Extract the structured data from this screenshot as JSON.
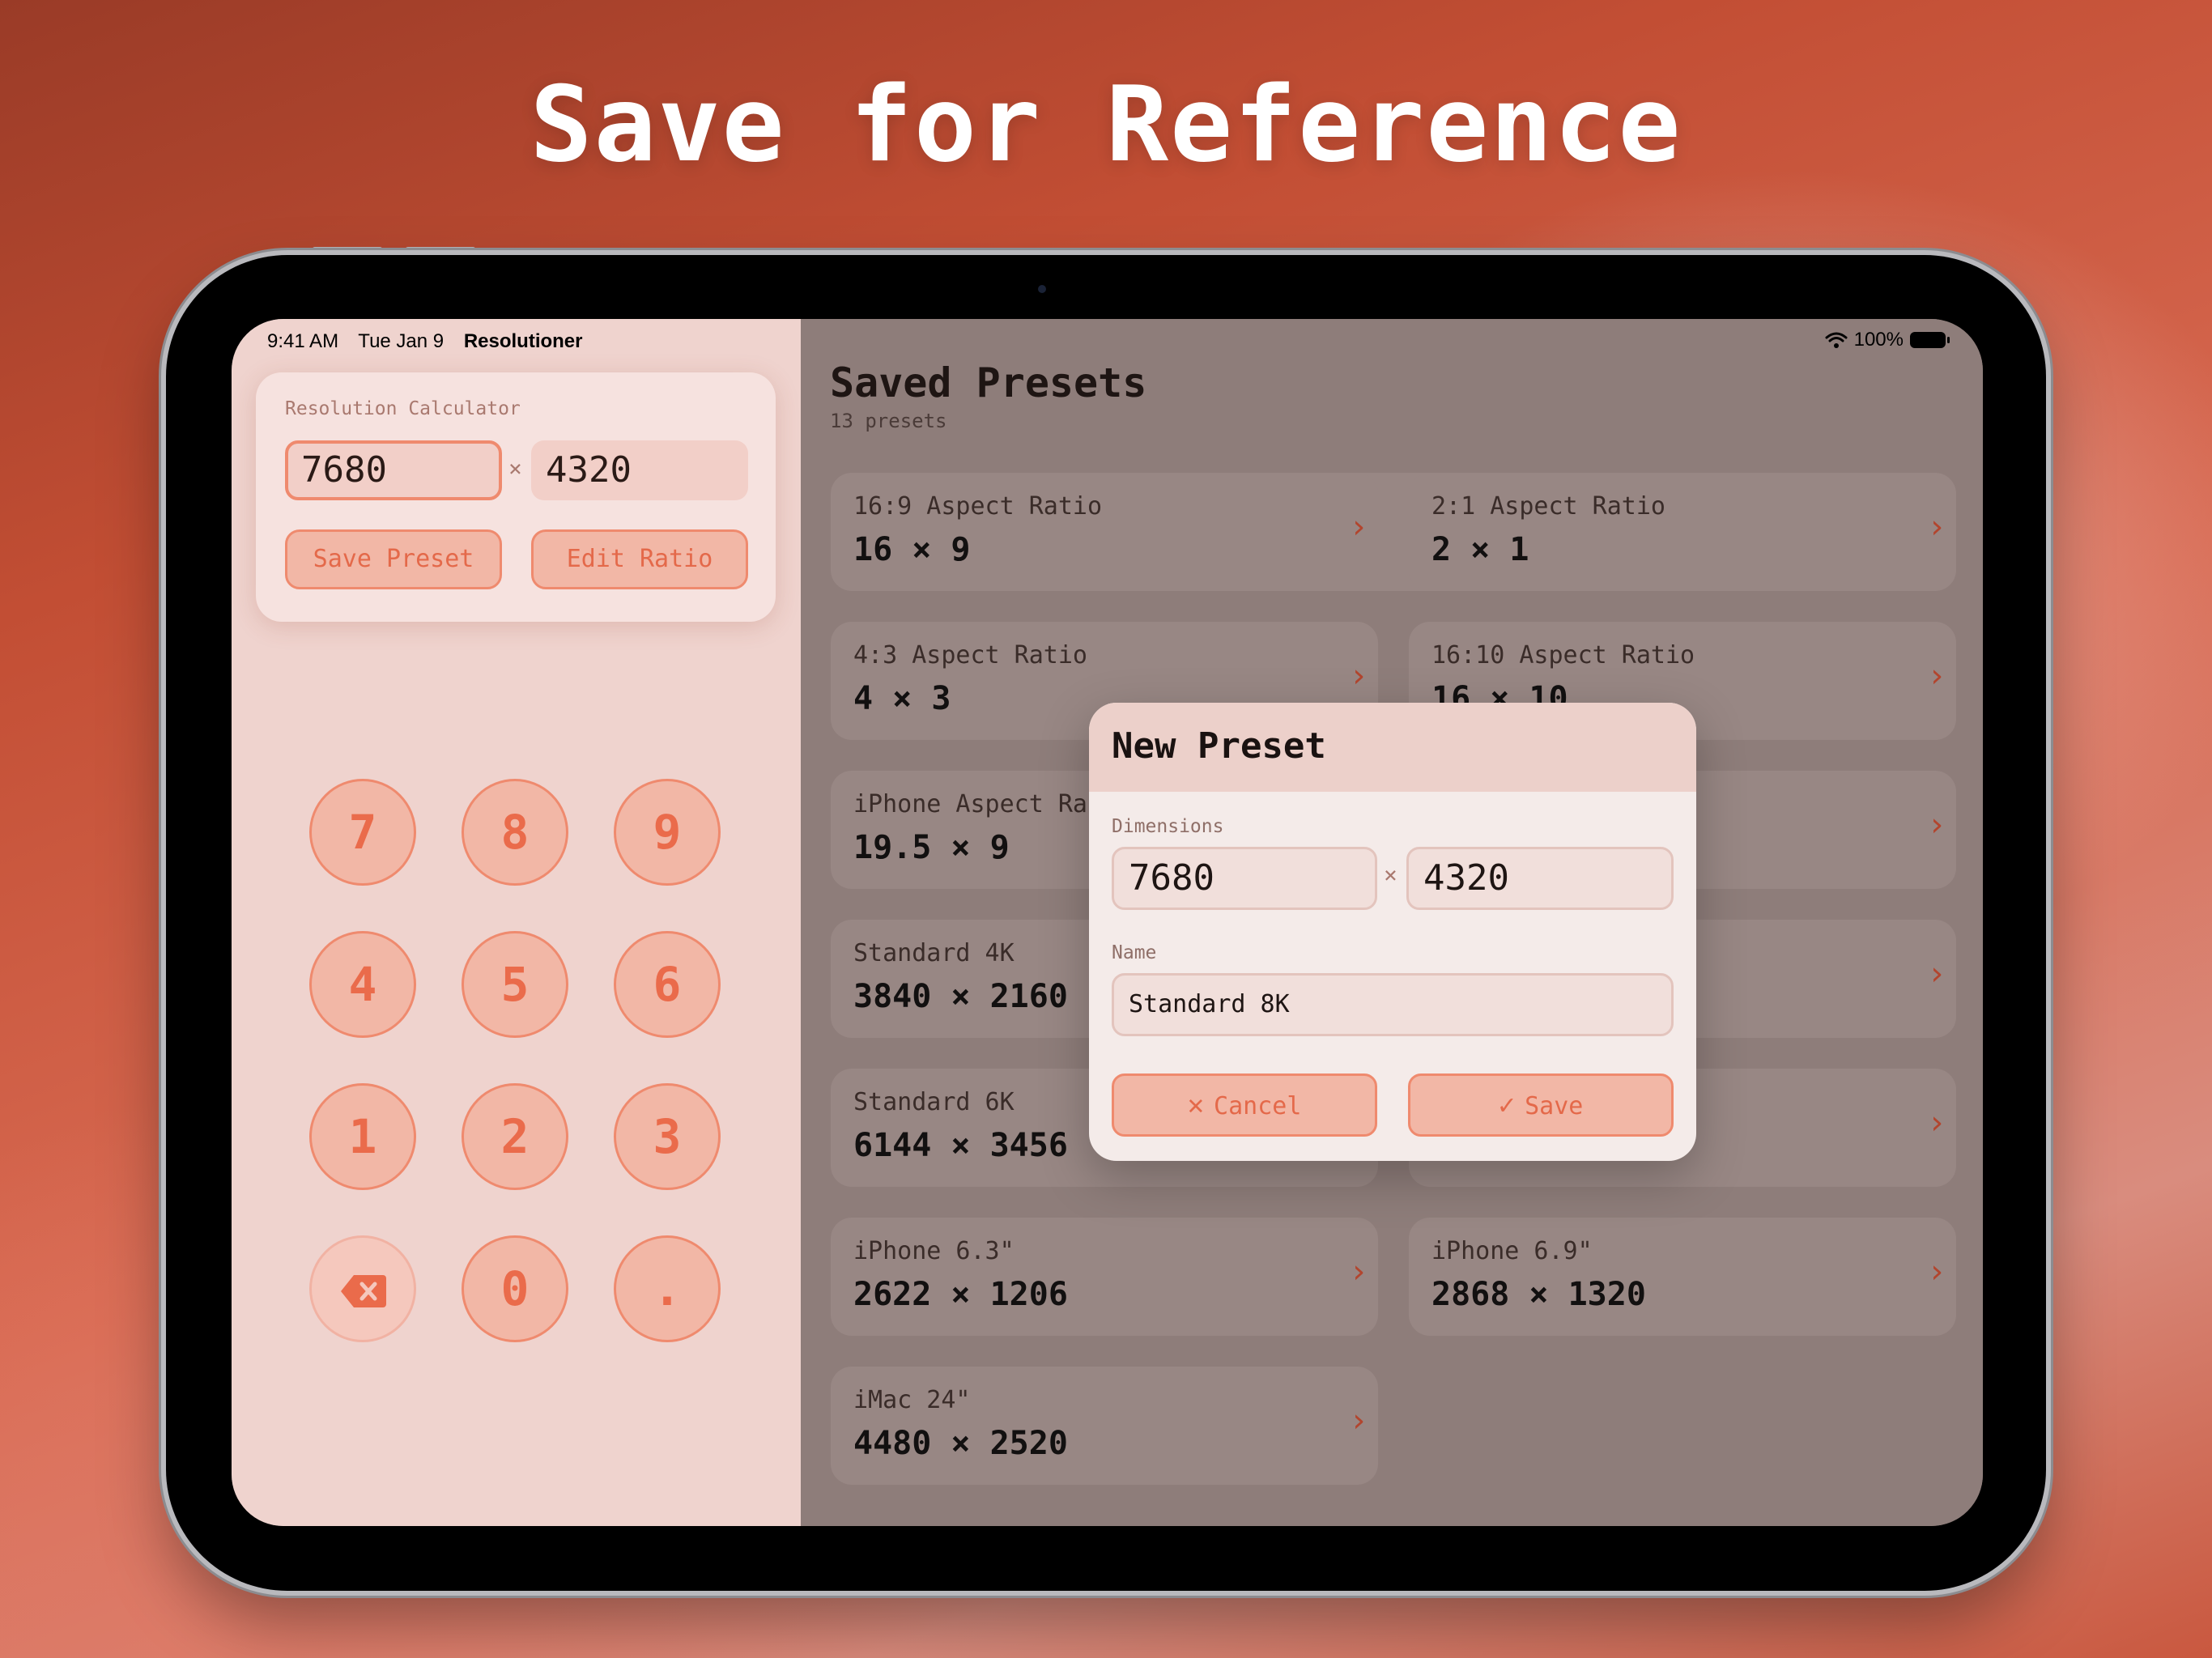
{
  "headline": "Save for Reference",
  "status_bar": {
    "time": "9:41 AM",
    "date": "Tue Jan 9",
    "app_name": "Resolutioner",
    "battery": "100%",
    "wifi_icon": "wifi-icon"
  },
  "calculator": {
    "title": "Resolution Calculator",
    "width_value": "7680",
    "height_value": "4320",
    "times_symbol": "×",
    "save_preset_label": "Save Preset",
    "edit_ratio_label": "Edit Ratio"
  },
  "keypad": {
    "keys": [
      "7",
      "8",
      "9",
      "4",
      "5",
      "6",
      "1",
      "2",
      "3",
      "⌫",
      "0",
      "."
    ],
    "delete_icon": "backspace-icon"
  },
  "presets_panel": {
    "title": "Saved Presets",
    "count": "13 presets",
    "settings_icon": "gear-icon",
    "add_icon": "plus-icon",
    "presets": [
      {
        "name": "16:9 Aspect Ratio",
        "value": "16 × 9"
      },
      {
        "name": "2:1 Aspect Ratio",
        "value": "2 × 1"
      },
      {
        "name": "4:3 Aspect Ratio",
        "value": "4 × 3"
      },
      {
        "name": "16:10 Aspect Ratio",
        "value": "16 × 10"
      },
      {
        "name": "iPhone Aspect Ra",
        "value": "19.5 × 9"
      },
      {
        "name": "",
        "value": ""
      },
      {
        "name": "Standard 4K",
        "value": "3840 × 2160"
      },
      {
        "name": "",
        "value": ""
      },
      {
        "name": "Standard 6K",
        "value": "6144 × 3456"
      },
      {
        "name": "",
        "value": ""
      },
      {
        "name": "iPhone 6.3\"",
        "value": "2622 × 1206"
      },
      {
        "name": "iPhone 6.9\"",
        "value": "2868 × 1320"
      },
      {
        "name": "iMac 24\"",
        "value": "4480 × 2520"
      }
    ]
  },
  "dialog": {
    "title": "New Preset",
    "dimensions_label": "Dimensions",
    "width_value": "7680",
    "height_value": "4320",
    "times_symbol": "×",
    "name_label": "Name",
    "name_value": "Standard 8K",
    "cancel_label": "Cancel",
    "save_label": "Save"
  },
  "colors": {
    "accent": "#ea6b4b",
    "accent_light": "#f2b7a6",
    "add_button": "#b4412b"
  }
}
